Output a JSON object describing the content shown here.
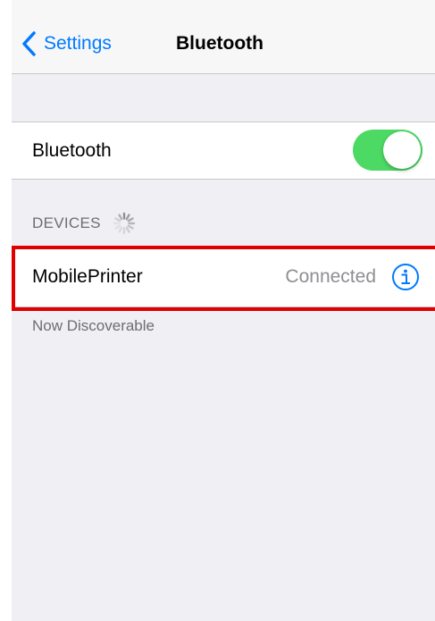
{
  "navbar": {
    "back_label": "Settings",
    "title": "Bluetooth"
  },
  "bluetooth_toggle": {
    "label": "Bluetooth",
    "state": "on",
    "on_color": "#4cd964"
  },
  "devices_section": {
    "header": "DEVICES",
    "loading_indicator": "spinner-icon",
    "items": [
      {
        "name": "MobilePrinter",
        "status": "Connected",
        "action_icon": "info-icon",
        "highlighted": true
      }
    ],
    "footer": "Now Discoverable"
  },
  "colors": {
    "accent": "#007aff",
    "background": "#efeff4",
    "highlight": "#e00000",
    "secondary_text": "#8e8e93"
  }
}
